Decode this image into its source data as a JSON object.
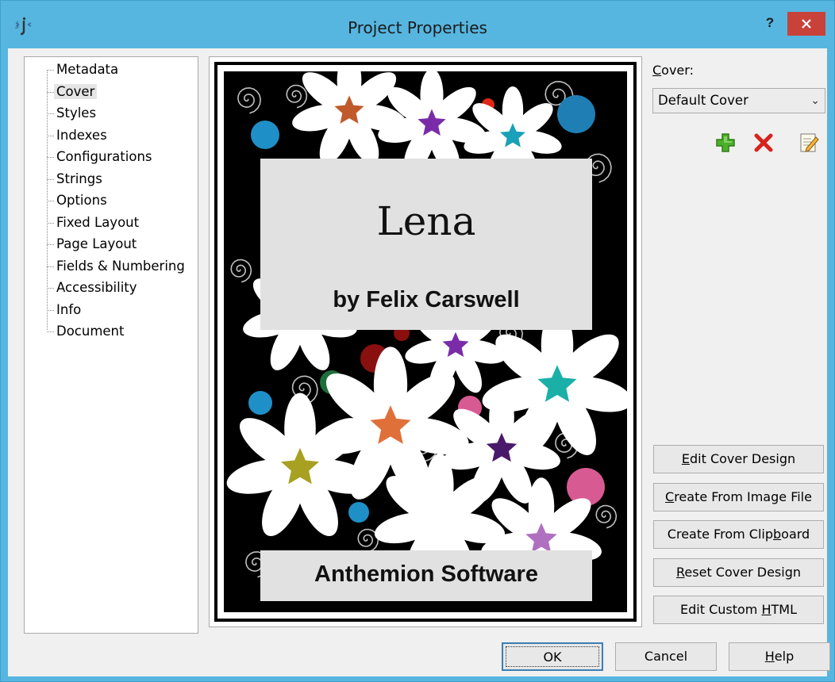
{
  "window": {
    "title": "Project Properties",
    "help_label": "?"
  },
  "tree": {
    "items": [
      {
        "label": "Metadata"
      },
      {
        "label": "Cover",
        "selected": true
      },
      {
        "label": "Styles"
      },
      {
        "label": "Indexes"
      },
      {
        "label": "Configurations"
      },
      {
        "label": "Strings"
      },
      {
        "label": "Options"
      },
      {
        "label": "Fixed Layout"
      },
      {
        "label": "Page Layout"
      },
      {
        "label": "Fields & Numbering"
      },
      {
        "label": "Accessibility"
      },
      {
        "label": "Info"
      },
      {
        "label": "Document"
      }
    ]
  },
  "cover_preview": {
    "title": "Lena",
    "author": "by Felix Carswell",
    "publisher": "Anthemion Software"
  },
  "cover_panel": {
    "label_accel": "C",
    "label_rest": "over:",
    "selected_cover": "Default Cover",
    "icons": [
      "add-icon",
      "delete-icon",
      "edit-icon"
    ]
  },
  "side_buttons": [
    {
      "pre": "",
      "accel": "E",
      "post": "dit Cover Design"
    },
    {
      "pre": "",
      "accel": "C",
      "post": "reate From Image File"
    },
    {
      "pre": "Create From Clip",
      "accel": "b",
      "post": "oard"
    },
    {
      "pre": "",
      "accel": "R",
      "post": "eset Cover Design"
    },
    {
      "pre": "Edit Custom ",
      "accel": "H",
      "post": "TML"
    }
  ],
  "footer": {
    "ok_label": "OK",
    "cancel_label": "Cancel",
    "help_accel": "H",
    "help_rest": "elp"
  },
  "colors": {
    "titlebar": "#56b6e0",
    "close_button": "#c9423a",
    "dialog_bg": "#f0f0f0"
  }
}
